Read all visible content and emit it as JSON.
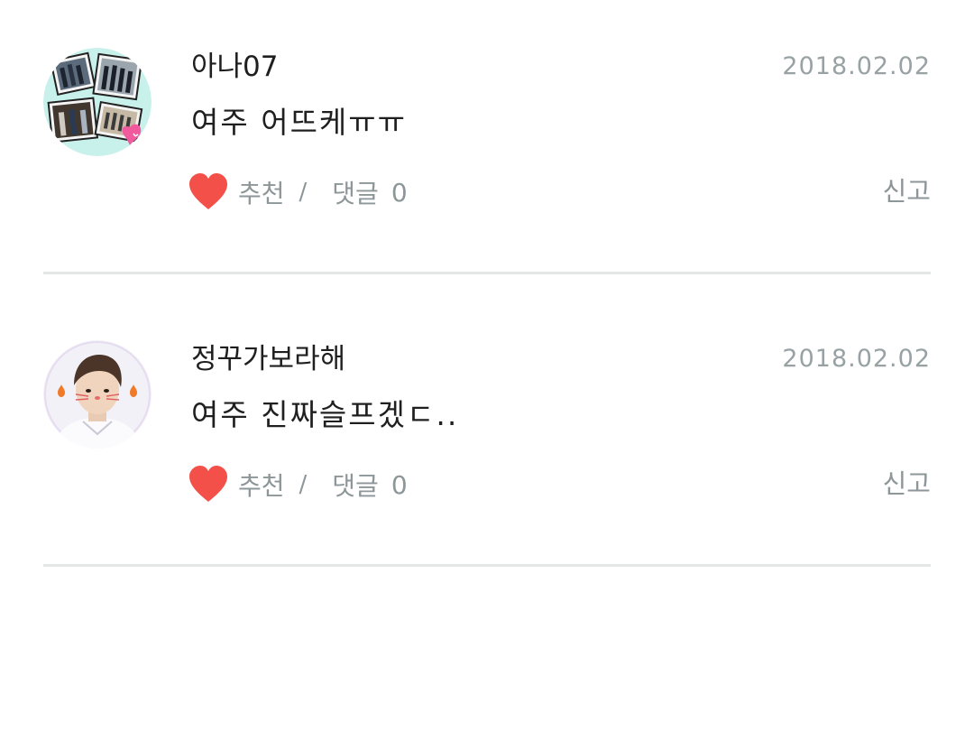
{
  "comments": [
    {
      "author": "아나07",
      "date": "2018.02.02",
      "text": "여주 어뜨케ㅠㅠ",
      "recommend_label": "추천",
      "separator": "/",
      "reply_label": "댓글",
      "reply_count": "0",
      "report_label": "신고",
      "avatar_icon": "photo-collage-avatar"
    },
    {
      "author": "정꾸가보라해",
      "date": "2018.02.02",
      "text": "여주 진짜슬프겠ㄷ..",
      "recommend_label": "추천",
      "separator": "/",
      "reply_label": "댓글",
      "reply_count": "0",
      "report_label": "신고",
      "avatar_icon": "person-photo-avatar"
    }
  ],
  "colors": {
    "heart": "#f4504a",
    "meta_text": "#8d9698",
    "divider": "#e3e8e7",
    "primary_text": "#1f1f1f"
  }
}
